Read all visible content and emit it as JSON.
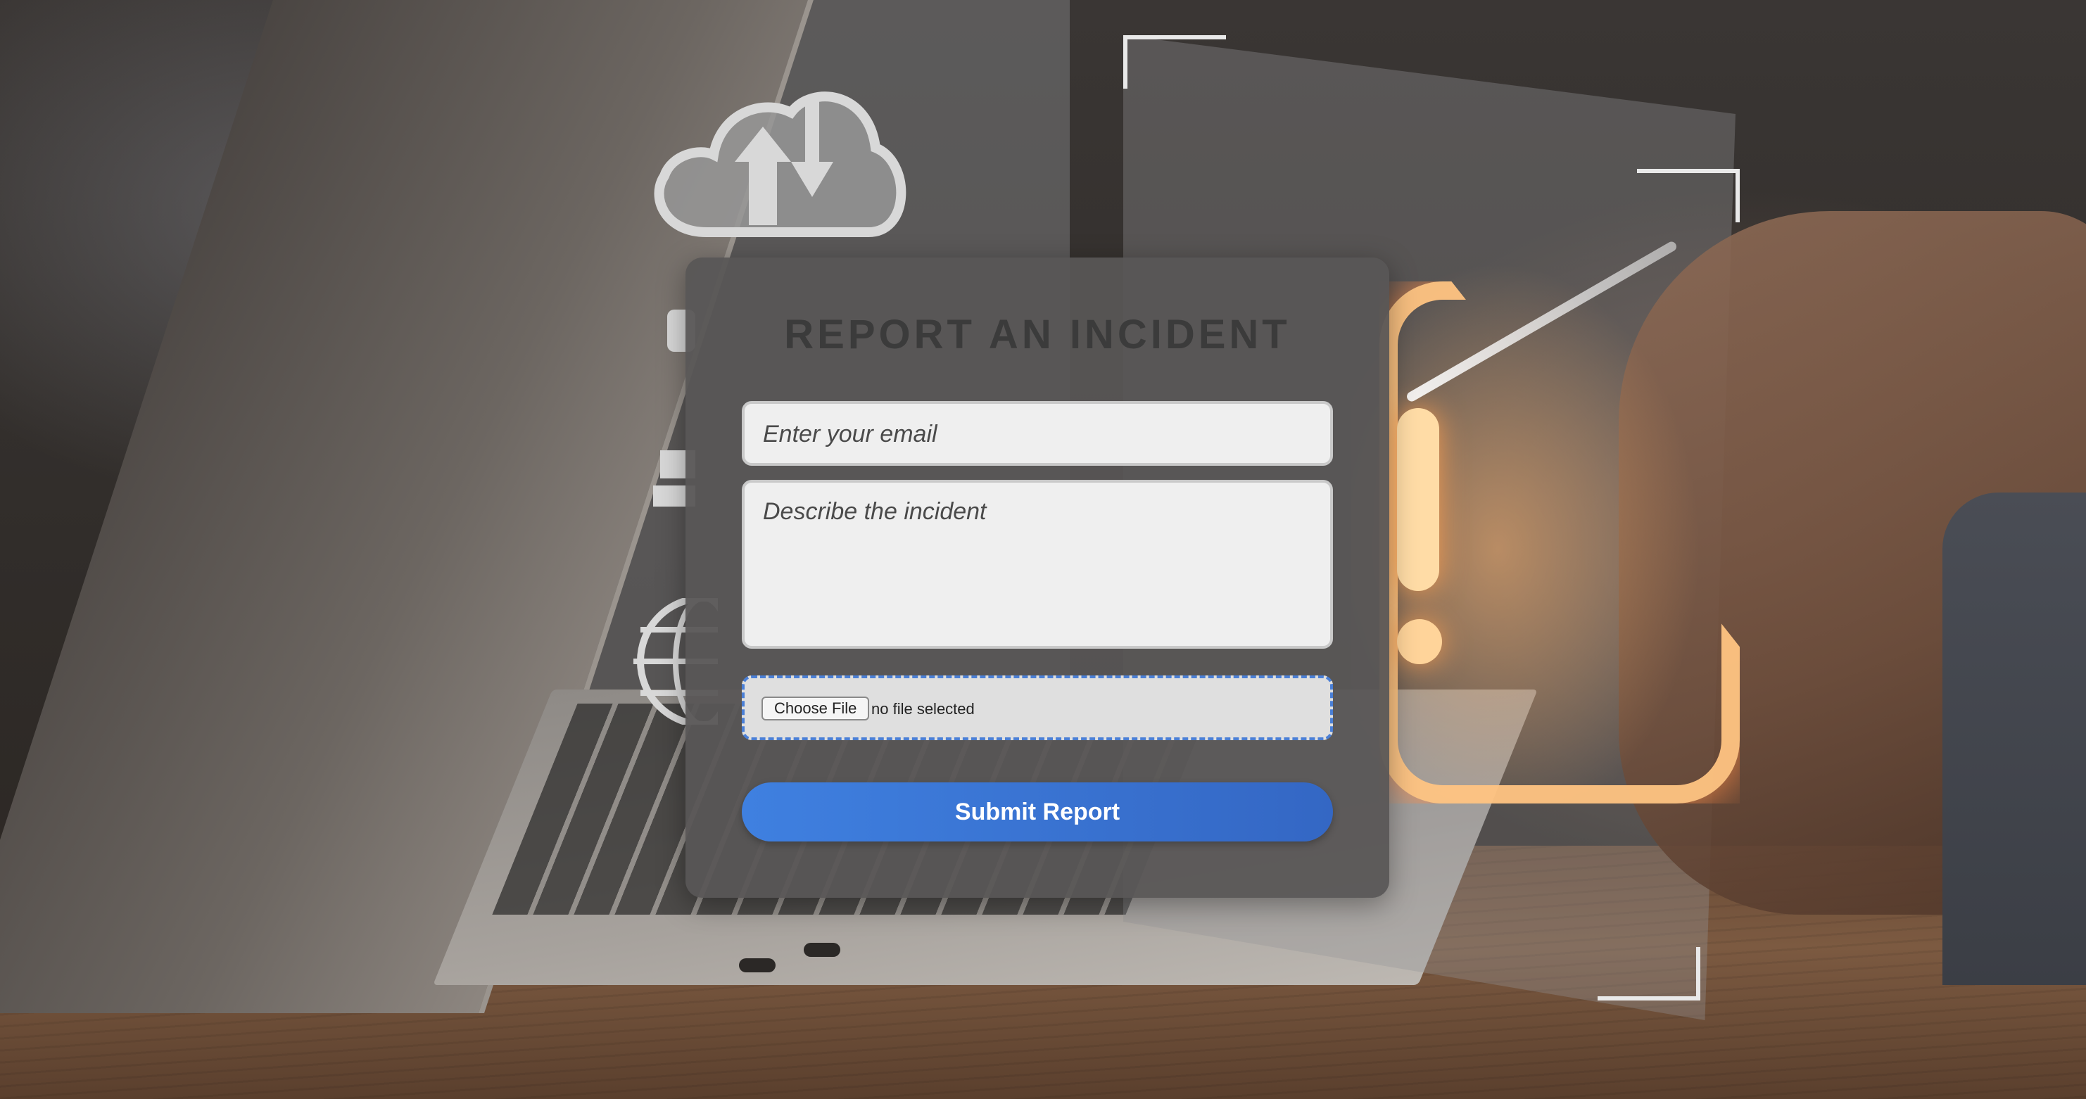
{
  "form": {
    "title": "REPORT AN INCIDENT",
    "email_placeholder": "Enter your email",
    "description_placeholder": "Describe the incident",
    "file_button_label": "Choose File",
    "file_status": "no file selected",
    "submit_label": "Submit Report"
  },
  "colors": {
    "accent": "#3f80e0",
    "card_background": "#585656",
    "title_text": "#3b3b3b",
    "field_background": "#efefef",
    "file_border": "#4a7fd6",
    "warning_glow": "#ffb46e"
  },
  "icons": {
    "background": [
      "cloud-sync-icon",
      "globe-icon",
      "warning-triangle-icon"
    ]
  }
}
